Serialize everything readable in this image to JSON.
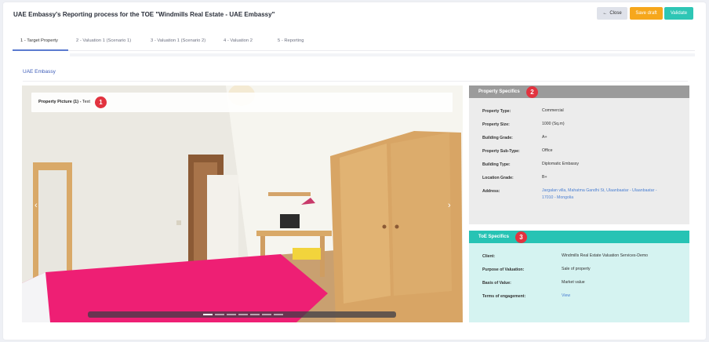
{
  "header": {
    "title": "UAE Embassy's Reporting process for the TOE \"Windmills Real Estate - UAE Embassy\"",
    "close_label": "Close",
    "save_draft_label": "Save draft",
    "validate_label": "Validate"
  },
  "tabs": [
    {
      "label": "1 - Target Property"
    },
    {
      "label": "2 - Valuation 1 (Scenario 1)"
    },
    {
      "label": "3 - Valuation 1 (Scenario 2)"
    },
    {
      "label": "4 - Valuation 2"
    },
    {
      "label": "5 - Reporting"
    }
  ],
  "section": {
    "title": "UAE Embassy"
  },
  "photo": {
    "caption_bold": "Property Picture (1) -",
    "caption_text": " Text",
    "badge": "1",
    "slide_count": 7,
    "active_slide": 1
  },
  "property_specifics": {
    "title": "Property Specifics",
    "badge": "2",
    "rows": [
      {
        "label": "Property Type:",
        "value": "Commercial"
      },
      {
        "label": "Property Size:",
        "value": "1000 (Sq.m)"
      },
      {
        "label": "Building Grade:",
        "value": "A+"
      },
      {
        "label": "Property Sub-Type:",
        "value": "Office"
      },
      {
        "label": "Building Type:",
        "value": "Diplomatic Embassy"
      },
      {
        "label": "Location Grade:",
        "value": "B+"
      },
      {
        "label": "Address:",
        "value_line1": "Jargalan villa, Mahatma Gandhi St, Ulaanbaatar - Ulaanbaatar -",
        "value_line2": "17010 - Mongolia"
      }
    ]
  },
  "toe_specifics": {
    "title": "ToE Specifics",
    "badge": "3",
    "rows": [
      {
        "label": "Client:",
        "value": "Windmills Real Estate Valuation Services-Demo"
      },
      {
        "label": "Purpose of Valuation:",
        "value": "Sale of property"
      },
      {
        "label": "Basis of Value:",
        "value": "Market value"
      },
      {
        "label": "Terms of engagement:",
        "value": "View"
      }
    ]
  },
  "colors": {
    "accent_blue": "#3d5cb8",
    "draft_orange": "#f6a71c",
    "validate_teal": "#2ec6b5",
    "badge_red": "#e2333f"
  }
}
